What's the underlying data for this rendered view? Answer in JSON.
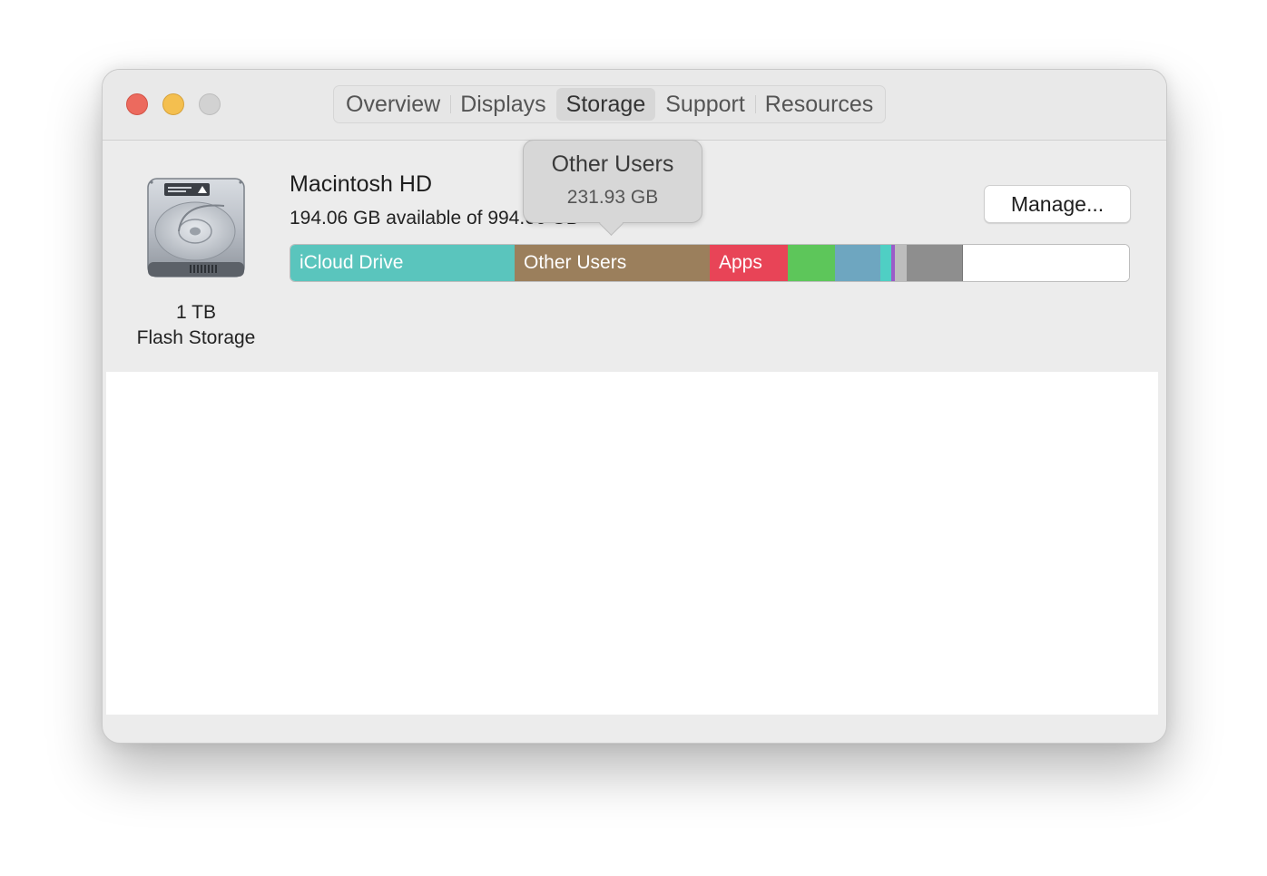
{
  "window": {
    "tabs": [
      {
        "label": "Overview"
      },
      {
        "label": "Displays"
      },
      {
        "label": "Storage"
      },
      {
        "label": "Support"
      },
      {
        "label": "Resources"
      }
    ],
    "selected_tab": "Storage"
  },
  "disk": {
    "capacity": "1 TB",
    "type": "Flash Storage",
    "icon": "internal-hard-drive-icon"
  },
  "volume": {
    "name": "Macintosh HD",
    "available_text": "194.06 GB available of 994.66 GB"
  },
  "manage_button_label": "Manage...",
  "tooltip": {
    "title": "Other Users",
    "value": "231.93 GB"
  },
  "storage_bar": {
    "segments": [
      {
        "label": "iCloud Drive",
        "fraction": 0.267,
        "color": "#5ac5bd"
      },
      {
        "label": "Other Users",
        "fraction": 0.233,
        "color": "#9b7f5c"
      },
      {
        "label": "Apps",
        "fraction": 0.093,
        "color": "#e84457"
      },
      {
        "label": "",
        "fraction": 0.056,
        "color": "#5dc65a"
      },
      {
        "label": "",
        "fraction": 0.054,
        "color": "#6ea6c0"
      },
      {
        "label": "",
        "fraction": 0.013,
        "color": "#4fcfc4"
      },
      {
        "label": "",
        "fraction": 0.004,
        "color": "#9b5cc8"
      },
      {
        "label": "",
        "fraction": 0.014,
        "color": "#bdbdbd"
      },
      {
        "label": "",
        "fraction": 0.066,
        "color": "#8e8e8e"
      }
    ],
    "free_color": "#ffffff"
  }
}
